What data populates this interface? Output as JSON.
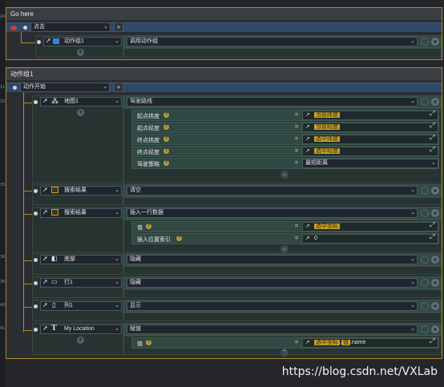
{
  "gutter_numbers": [
    "24",
    "32",
    "35",
    "11",
    "36",
    "36",
    "40",
    "41"
  ],
  "panel1": {
    "title": "Go here",
    "trigger": "点击",
    "action_component": "动作组1",
    "action": "调用动作组"
  },
  "panel2": {
    "title": "动作组1",
    "trigger": "动作开始",
    "rows": [
      {
        "component": "地图1",
        "action": "驾驶路线",
        "params": [
          {
            "label": "起点纬度",
            "value": "当前纬度"
          },
          {
            "label": "起点经度",
            "value": "当前经度"
          },
          {
            "label": "终点纬度",
            "value": "选中纬度"
          },
          {
            "label": "终点经度",
            "value": "选中经度"
          },
          {
            "label": "驾驶策略",
            "value": "最短距离"
          }
        ]
      },
      {
        "component": "搜索结果",
        "action": "清空"
      },
      {
        "component": "搜索结果",
        "action": "插入一行数据",
        "params": [
          {
            "label": "值",
            "value": "选中坐标"
          },
          {
            "label": "插入位置索引",
            "value": "0"
          }
        ]
      },
      {
        "component": "底部",
        "action": "隐藏"
      },
      {
        "component": "行1",
        "action": "隐藏"
      },
      {
        "component": "列1",
        "action": "显示"
      },
      {
        "component": "My Location",
        "action": "赋值",
        "params": [
          {
            "label": "值",
            "value_tag1": "选中坐标",
            "value_tag2": "值",
            "value_suffix": ".name"
          }
        ]
      }
    ]
  },
  "common": {
    "equals": "=",
    "plus": "+",
    "help": "?"
  },
  "watermark": "https://blog.csdn.net/VXLab"
}
